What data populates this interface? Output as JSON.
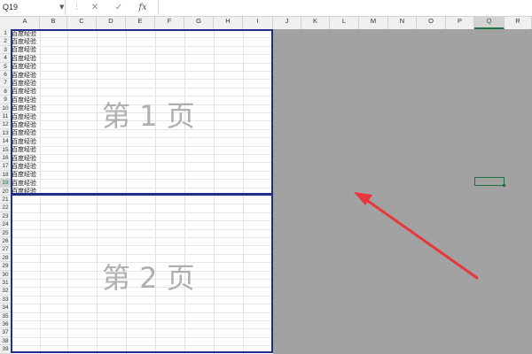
{
  "formula_bar": {
    "name_box": "Q19",
    "cancel_icon": "close-icon",
    "enter_icon": "check-icon",
    "fx_label": "fx",
    "formula": ""
  },
  "columns": [
    "A",
    "B",
    "C",
    "D",
    "E",
    "F",
    "G",
    "H",
    "I",
    "J",
    "K",
    "L",
    "M",
    "N",
    "O",
    "P",
    "Q",
    "R"
  ],
  "active_column": "Q",
  "rows": [
    "1",
    "2",
    "3",
    "4",
    "5",
    "6",
    "7",
    "8",
    "9",
    "10",
    "11",
    "12",
    "13",
    "14",
    "15",
    "16",
    "17",
    "18",
    "19",
    "20",
    "21",
    "22",
    "23",
    "24",
    "25",
    "26",
    "27",
    "28",
    "29",
    "30",
    "31",
    "32",
    "33",
    "34",
    "35",
    "36",
    "37",
    "38",
    "39"
  ],
  "active_row": "19",
  "column_a_values": [
    "百度经验",
    "百度经验",
    "百度经验",
    "百度经验",
    "百度经验",
    "百度经验",
    "百度经验",
    "百度经验",
    "百度经验",
    "百度经验",
    "百度经验",
    "百度经验",
    "百度经验",
    "百度经验",
    "百度经验",
    "百度经验",
    "百度经验",
    "百度经验",
    "百度经验",
    "百度经验"
  ],
  "pages": [
    {
      "watermark": "第 1 页"
    },
    {
      "watermark": "第 2 页"
    }
  ],
  "colors": {
    "page_border": "#1f2f8a",
    "outside_area": "#a2a2a2",
    "selection": "#217346",
    "arrow": "#e8373a"
  }
}
